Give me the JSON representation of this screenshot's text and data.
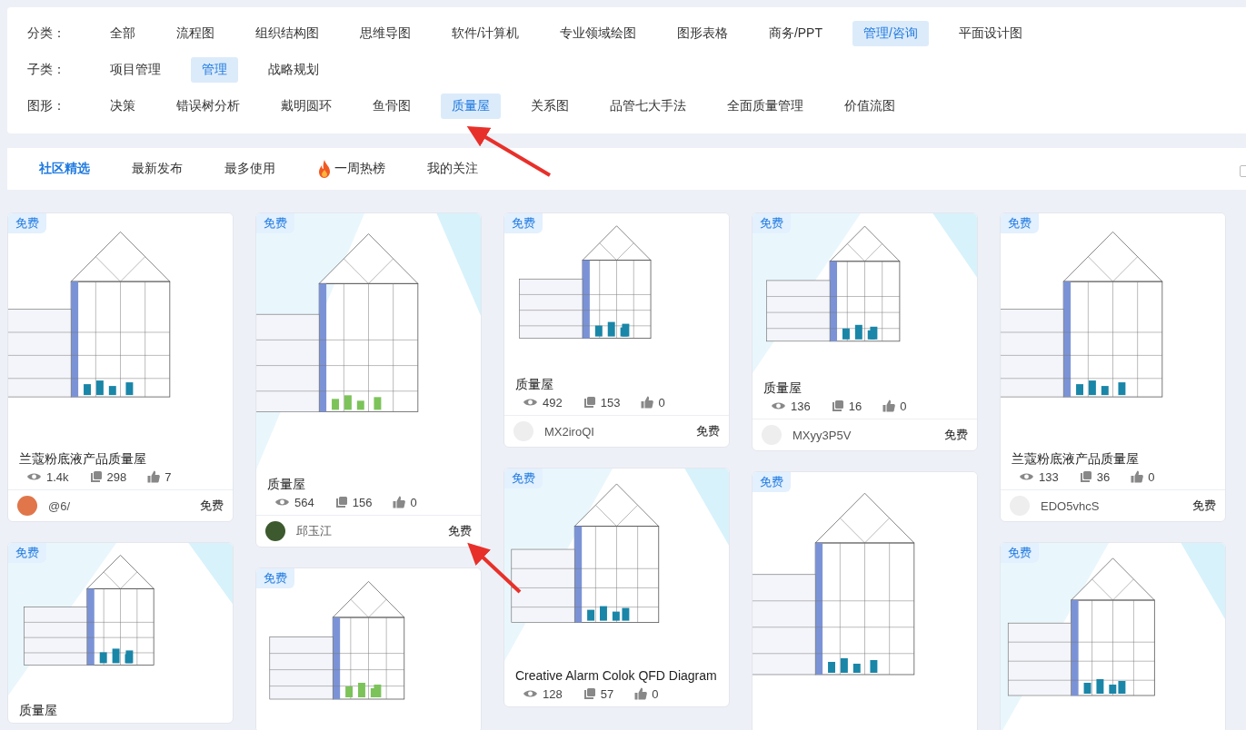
{
  "filters": [
    {
      "label": "分类：",
      "options": [
        {
          "label": "全部",
          "selected": false
        },
        {
          "label": "流程图",
          "selected": false
        },
        {
          "label": "组织结构图",
          "selected": false
        },
        {
          "label": "思维导图",
          "selected": false
        },
        {
          "label": "软件/计算机",
          "selected": false
        },
        {
          "label": "专业领域绘图",
          "selected": false
        },
        {
          "label": "图形表格",
          "selected": false
        },
        {
          "label": "商务/PPT",
          "selected": false
        },
        {
          "label": "管理/咨询",
          "selected": true
        },
        {
          "label": "平面设计图",
          "selected": false
        }
      ]
    },
    {
      "label": "子类：",
      "options": [
        {
          "label": "项目管理",
          "selected": false
        },
        {
          "label": "管理",
          "selected": true
        },
        {
          "label": "战略规划",
          "selected": false
        }
      ]
    },
    {
      "label": "图形：",
      "options": [
        {
          "label": "决策",
          "selected": false
        },
        {
          "label": "错误树分析",
          "selected": false
        },
        {
          "label": "戴明圆环",
          "selected": false
        },
        {
          "label": "鱼骨图",
          "selected": false
        },
        {
          "label": "质量屋",
          "selected": true
        },
        {
          "label": "关系图",
          "selected": false
        },
        {
          "label": "品管七大手法",
          "selected": false
        },
        {
          "label": "全面质量管理",
          "selected": false
        },
        {
          "label": "价值流图",
          "selected": false
        }
      ]
    }
  ],
  "feed_tabs": [
    {
      "label": "社区精选",
      "selected": true,
      "kind": "plain"
    },
    {
      "label": "最新发布",
      "selected": false,
      "kind": "plain"
    },
    {
      "label": "最多使用",
      "selected": false,
      "kind": "plain"
    },
    {
      "label": "一周热榜",
      "selected": false,
      "kind": "hot"
    },
    {
      "label": "我的关注",
      "selected": false,
      "kind": "plain"
    }
  ],
  "feed_checkbox": {
    "checked": false
  },
  "columns": [
    [
      {
        "badge": "免费",
        "title": "兰蔻粉底液产品质量屋",
        "views": "1.4k",
        "copies": "298",
        "likes": "7",
        "author": {
          "name": "@6/",
          "color": "#e0764a"
        },
        "price": "免费"
      },
      {
        "badge": "免费",
        "title": "质量屋"
      }
    ],
    [
      {
        "badge": "免费",
        "title": "质量屋",
        "views": "564",
        "copies": "156",
        "likes": "0",
        "author": {
          "name": "邱玉江",
          "color": "#3c5a2e"
        },
        "price": "免费"
      },
      {
        "badge": "免费"
      }
    ],
    [
      {
        "badge": "免费",
        "title": "质量屋",
        "views": "492",
        "copies": "153",
        "likes": "0",
        "author": {
          "name": "MX2iroQI",
          "color": "#eeeeee"
        },
        "price": "免费"
      },
      {
        "badge": "免费",
        "title": "Creative Alarm Colok QFD Diagram",
        "views": "128",
        "copies": "57",
        "likes": "0"
      }
    ],
    [
      {
        "badge": "免费",
        "title": "质量屋",
        "views": "136",
        "copies": "16",
        "likes": "0",
        "author": {
          "name": "MXyy3P5V",
          "color": "#eeeeee"
        },
        "price": "免费"
      },
      {
        "badge": "免费"
      }
    ],
    [
      {
        "badge": "免费",
        "title": "兰蔻粉底液产品质量屋",
        "views": "133",
        "copies": "36",
        "likes": "0",
        "author": {
          "name": "EDO5vhcS",
          "color": "#eeeeee"
        },
        "price": "免费"
      },
      {
        "badge": "免费"
      }
    ]
  ]
}
